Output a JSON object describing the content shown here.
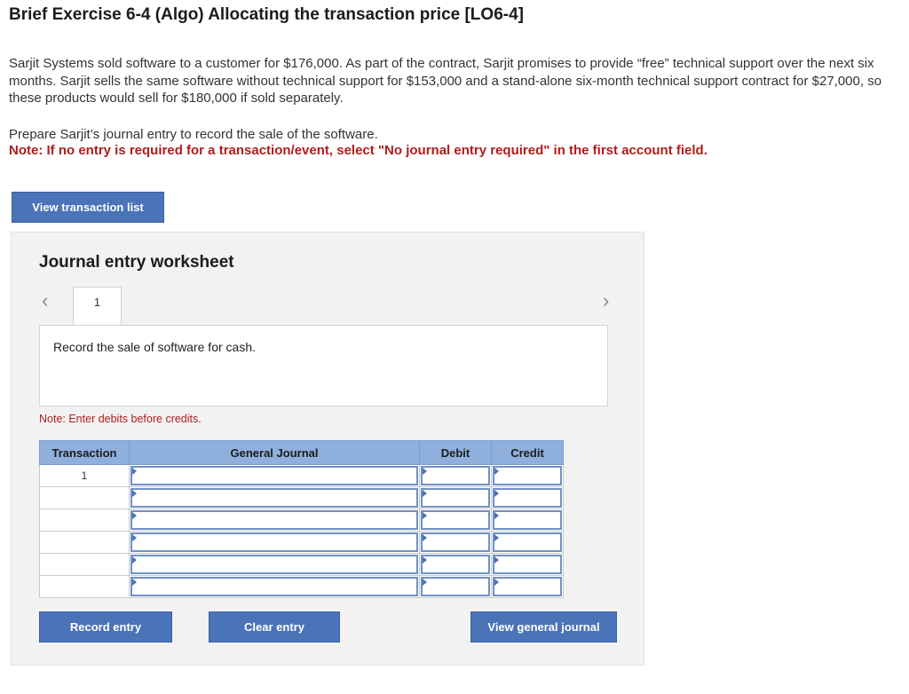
{
  "header": {
    "title": "Brief Exercise 6-4 (Algo) Allocating the transaction price [LO6-4]"
  },
  "problem": {
    "paragraph": "Sarjit Systems sold software to a customer for $176,000. As part of the contract, Sarjit promises to provide “free” technical support over the next six months. Sarjit sells the same software without technical support for $153,000 and a stand-alone six-month technical support contract for $27,000, so these products would sell for $180,000 if sold separately.",
    "instruction": "Prepare Sarjit’s journal entry to record the sale of the software.",
    "note": "Note: If no entry is required for a transaction/event, select \"No journal entry required\" in the first account field."
  },
  "buttons": {
    "view_transaction_list": "View transaction list",
    "record_entry": "Record entry",
    "clear_entry": "Clear entry",
    "view_general_journal": "View general journal"
  },
  "worksheet": {
    "title": "Journal entry worksheet",
    "prev_icon": "chevron-left-icon",
    "next_icon": "chevron-right-icon",
    "page_tab": "1",
    "description": "Record the sale of software for cash.",
    "note": "Note: Enter debits before credits."
  },
  "journal_table": {
    "headers": {
      "transaction": "Transaction",
      "general_journal": "General Journal",
      "debit": "Debit",
      "credit": "Credit"
    },
    "rows": [
      {
        "transaction": "1",
        "account": "",
        "debit": "",
        "credit": ""
      },
      {
        "transaction": "",
        "account": "",
        "debit": "",
        "credit": ""
      },
      {
        "transaction": "",
        "account": "",
        "debit": "",
        "credit": ""
      },
      {
        "transaction": "",
        "account": "",
        "debit": "",
        "credit": ""
      },
      {
        "transaction": "",
        "account": "",
        "debit": "",
        "credit": ""
      },
      {
        "transaction": "",
        "account": "",
        "debit": "",
        "credit": ""
      }
    ]
  },
  "colors": {
    "button_bg": "#4a73b8",
    "table_header_bg": "#8fb0dd",
    "note_red": "#b01c1c",
    "panel_bg": "#f2f2f2"
  }
}
